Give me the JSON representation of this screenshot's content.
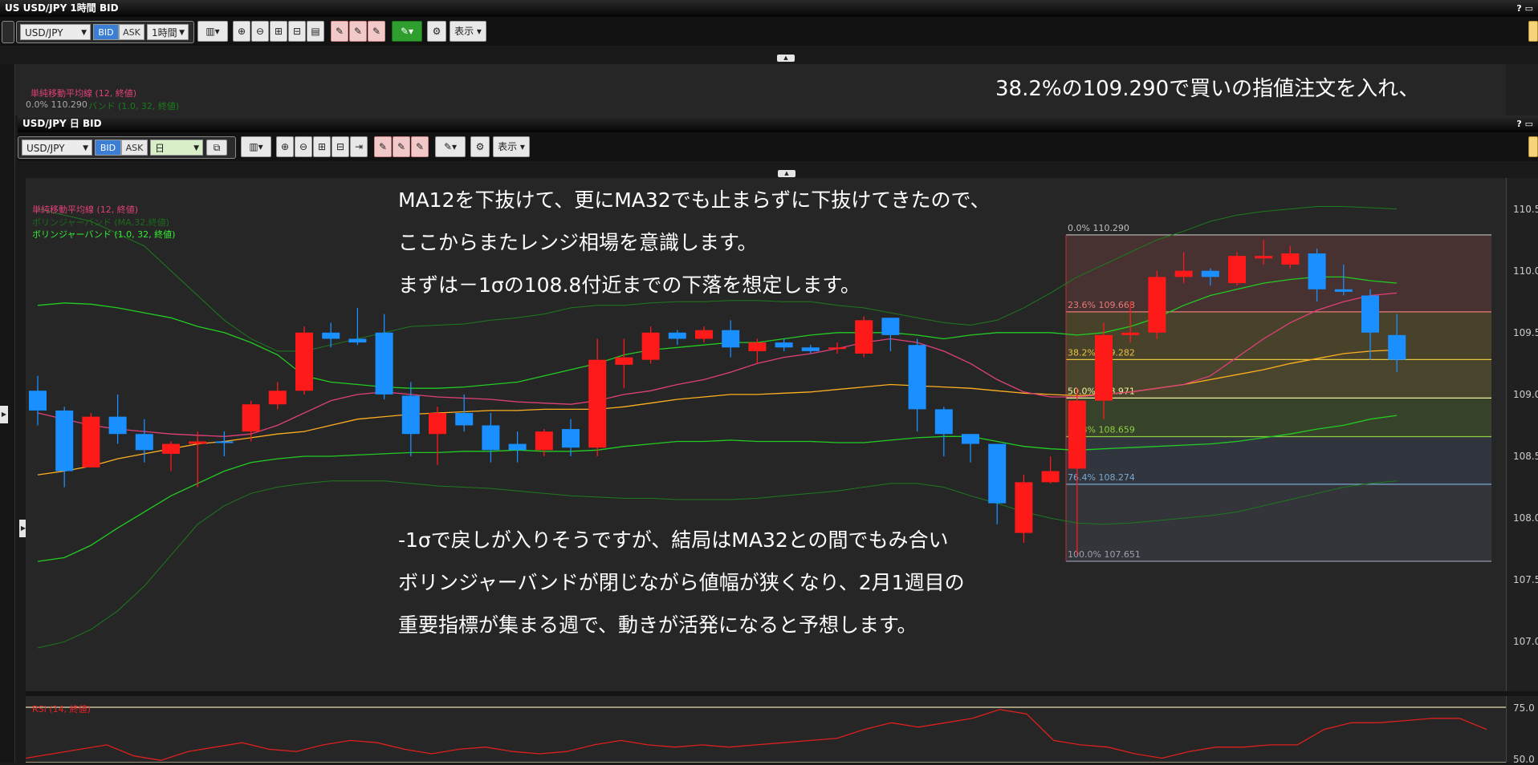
{
  "top_window": {
    "title": "USD/JPY 1時間 BID",
    "title_prefix": "US",
    "help": "?",
    "symbol": "USD/JPY",
    "bid": "BID",
    "ask": "ASK",
    "timeframe": "1時間",
    "display_menu": "表示",
    "sma_label": "単純移動平均線 (12, 終値)",
    "fib_label": "0.0% 110.290",
    "band_label": "バンド (1.0, 32, 終値)",
    "note": "38.2%の109.290で買いの指値注文を入れ、"
  },
  "main_window": {
    "title": "USD/JPY 日 BID",
    "help": "?",
    "symbol": "USD/JPY",
    "bid": "BID",
    "ask": "ASK",
    "timeframe": "日",
    "display_menu": "表示",
    "indicators": {
      "sma": "単純移動平均線 (12, 終値)",
      "bb_hidden": "ボリンジャーバンド (MA,32,終値)",
      "bb": "ボリンジャーバンド (1.0, 32, 終値)"
    },
    "notes": [
      "MA12を下抜けて、更にMA32でも止まらずに下抜けてきたので、",
      "ここからまたレンジ相場を意識します。",
      "まずは－1σの108.8付近までの下落を想定します。",
      "-1σで戻しが入りそうですが、結局はMA32との間でもみ合い",
      "ボリンジャーバンドが閉じながら値幅が狭くなり、2月1週目の",
      "重要指標が集まる週で、動きが活発になると予想します。"
    ],
    "price_scale": [
      "110.5",
      "110.0",
      "109.5",
      "109.0",
      "108.5",
      "108.0",
      "107.5",
      "107.0"
    ],
    "rsi_label": "RSI (14, 終値)",
    "rsi_scale": [
      "75.0",
      "50.0"
    ]
  },
  "colors": {
    "up": "#ff1a1a",
    "down": "#1a8fff",
    "sma": "#e0407a",
    "mid": "#ffb020",
    "band": "#22cc22",
    "accent_bid": "#3a7fd5"
  },
  "chart_data": {
    "type": "candlestick",
    "symbol": "USD/JPY",
    "timeframe": "日",
    "ylim": [
      106.6,
      110.75
    ],
    "candles": [
      {
        "o": 109.03,
        "h": 109.15,
        "l": 108.75,
        "c": 108.87
      },
      {
        "o": 108.87,
        "h": 108.9,
        "l": 108.25,
        "c": 108.38
      },
      {
        "o": 108.41,
        "h": 108.85,
        "l": 108.41,
        "c": 108.82
      },
      {
        "o": 108.82,
        "h": 109.0,
        "l": 108.6,
        "c": 108.68
      },
      {
        "o": 108.68,
        "h": 108.8,
        "l": 108.45,
        "c": 108.55
      },
      {
        "o": 108.52,
        "h": 108.62,
        "l": 108.38,
        "c": 108.6
      },
      {
        "o": 108.6,
        "h": 108.7,
        "l": 108.25,
        "c": 108.62
      },
      {
        "o": 108.62,
        "h": 108.7,
        "l": 108.5,
        "c": 108.61
      },
      {
        "o": 108.7,
        "h": 108.95,
        "l": 108.62,
        "c": 108.92
      },
      {
        "o": 108.92,
        "h": 109.1,
        "l": 108.88,
        "c": 109.03
      },
      {
        "o": 109.03,
        "h": 109.55,
        "l": 109.0,
        "c": 109.5
      },
      {
        "o": 109.5,
        "h": 109.58,
        "l": 109.38,
        "c": 109.45
      },
      {
        "o": 109.45,
        "h": 109.7,
        "l": 109.4,
        "c": 109.42
      },
      {
        "o": 109.5,
        "h": 109.65,
        "l": 108.96,
        "c": 109.0
      },
      {
        "o": 108.99,
        "h": 109.1,
        "l": 108.5,
        "c": 108.68
      },
      {
        "o": 108.68,
        "h": 108.9,
        "l": 108.43,
        "c": 108.85
      },
      {
        "o": 108.85,
        "h": 109.0,
        "l": 108.7,
        "c": 108.75
      },
      {
        "o": 108.75,
        "h": 108.85,
        "l": 108.45,
        "c": 108.55
      },
      {
        "o": 108.6,
        "h": 108.7,
        "l": 108.45,
        "c": 108.55
      },
      {
        "o": 108.55,
        "h": 108.72,
        "l": 108.5,
        "c": 108.7
      },
      {
        "o": 108.72,
        "h": 108.8,
        "l": 108.5,
        "c": 108.57
      },
      {
        "o": 108.57,
        "h": 109.45,
        "l": 108.5,
        "c": 109.28
      },
      {
        "o": 109.24,
        "h": 109.45,
        "l": 109.05,
        "c": 109.3
      },
      {
        "o": 109.28,
        "h": 109.55,
        "l": 109.25,
        "c": 109.5
      },
      {
        "o": 109.5,
        "h": 109.52,
        "l": 109.4,
        "c": 109.45
      },
      {
        "o": 109.45,
        "h": 109.55,
        "l": 109.42,
        "c": 109.52
      },
      {
        "o": 109.52,
        "h": 109.6,
        "l": 109.3,
        "c": 109.38
      },
      {
        "o": 109.35,
        "h": 109.45,
        "l": 109.25,
        "c": 109.42
      },
      {
        "o": 109.42,
        "h": 109.45,
        "l": 109.35,
        "c": 109.38
      },
      {
        "o": 109.38,
        "h": 109.4,
        "l": 109.33,
        "c": 109.35
      },
      {
        "o": 109.37,
        "h": 109.42,
        "l": 109.33,
        "c": 109.38
      },
      {
        "o": 109.33,
        "h": 109.63,
        "l": 109.3,
        "c": 109.6
      },
      {
        "o": 109.62,
        "h": 109.62,
        "l": 109.35,
        "c": 109.48
      },
      {
        "o": 109.4,
        "h": 109.45,
        "l": 108.7,
        "c": 108.88
      },
      {
        "o": 108.88,
        "h": 108.9,
        "l": 108.5,
        "c": 108.68
      },
      {
        "o": 108.68,
        "h": 108.68,
        "l": 108.45,
        "c": 108.6
      },
      {
        "o": 108.6,
        "h": 108.6,
        "l": 107.95,
        "c": 108.12
      },
      {
        "o": 107.88,
        "h": 108.35,
        "l": 107.8,
        "c": 108.29
      },
      {
        "o": 108.29,
        "h": 108.5,
        "l": 108.28,
        "c": 108.38
      },
      {
        "o": 108.4,
        "h": 109.05,
        "l": 107.7,
        "c": 108.95
      },
      {
        "o": 108.95,
        "h": 109.58,
        "l": 108.8,
        "c": 109.48
      },
      {
        "o": 109.48,
        "h": 109.75,
        "l": 109.42,
        "c": 109.5
      },
      {
        "o": 109.5,
        "h": 110.0,
        "l": 109.45,
        "c": 109.95
      },
      {
        "o": 109.95,
        "h": 110.15,
        "l": 109.9,
        "c": 110.0
      },
      {
        "o": 110.0,
        "h": 110.02,
        "l": 109.88,
        "c": 109.95
      },
      {
        "o": 109.9,
        "h": 110.15,
        "l": 109.88,
        "c": 110.12
      },
      {
        "o": 110.1,
        "h": 110.25,
        "l": 110.05,
        "c": 110.12
      },
      {
        "o": 110.05,
        "h": 110.2,
        "l": 110.02,
        "c": 110.14
      },
      {
        "o": 110.14,
        "h": 110.18,
        "l": 109.75,
        "c": 109.85
      },
      {
        "o": 109.85,
        "h": 110.05,
        "l": 109.8,
        "c": 109.83
      },
      {
        "o": 109.8,
        "h": 109.85,
        "l": 109.28,
        "c": 109.5
      },
      {
        "o": 109.48,
        "h": 109.65,
        "l": 109.18,
        "c": 109.28
      }
    ],
    "sma12": [
      108.85,
      108.8,
      108.75,
      108.72,
      108.7,
      108.68,
      108.67,
      108.66,
      108.68,
      108.75,
      108.85,
      108.95,
      109.0,
      109.02,
      109.0,
      108.98,
      108.97,
      108.96,
      108.94,
      108.93,
      108.92,
      108.95,
      109.0,
      109.03,
      109.08,
      109.12,
      109.18,
      109.25,
      109.3,
      109.33,
      109.37,
      109.42,
      109.45,
      109.42,
      109.35,
      109.25,
      109.12,
      109.02,
      108.98,
      108.98,
      109.0,
      109.02,
      109.05,
      109.08,
      109.15,
      109.3,
      109.45,
      109.58,
      109.68,
      109.75,
      109.8,
      109.82
    ],
    "bb_mid": [
      108.35,
      108.38,
      108.42,
      108.48,
      108.52,
      108.56,
      108.6,
      108.62,
      108.65,
      108.68,
      108.7,
      108.75,
      108.8,
      108.82,
      108.84,
      108.85,
      108.86,
      108.87,
      108.87,
      108.88,
      108.88,
      108.88,
      108.9,
      108.93,
      108.96,
      108.98,
      109.0,
      109.0,
      109.01,
      109.02,
      109.04,
      109.06,
      109.08,
      109.07,
      109.06,
      109.05,
      109.03,
      109.01,
      109.0,
      108.99,
      109.0,
      109.02,
      109.05,
      109.08,
      109.12,
      109.16,
      109.2,
      109.25,
      109.29,
      109.33,
      109.35,
      109.36
    ],
    "bb_upper": [
      109.72,
      109.74,
      109.73,
      109.7,
      109.66,
      109.62,
      109.55,
      109.5,
      109.42,
      109.32,
      109.15,
      109.1,
      109.08,
      109.06,
      109.05,
      109.05,
      109.06,
      109.08,
      109.1,
      109.15,
      109.2,
      109.25,
      109.32,
      109.36,
      109.38,
      109.4,
      109.42,
      109.42,
      109.45,
      109.48,
      109.5,
      109.5,
      109.5,
      109.48,
      109.45,
      109.48,
      109.5,
      109.5,
      109.5,
      109.48,
      109.5,
      109.55,
      109.62,
      109.72,
      109.8,
      109.85,
      109.9,
      109.93,
      109.95,
      109.95,
      109.92,
      109.9
    ],
    "bb_lower": [
      107.65,
      107.68,
      107.78,
      107.92,
      108.05,
      108.18,
      108.28,
      108.38,
      108.45,
      108.48,
      108.5,
      108.5,
      108.51,
      108.52,
      108.53,
      108.53,
      108.54,
      108.54,
      108.55,
      108.54,
      108.54,
      108.55,
      108.58,
      108.6,
      108.62,
      108.62,
      108.63,
      108.62,
      108.62,
      108.62,
      108.61,
      108.61,
      108.63,
      108.65,
      108.66,
      108.66,
      108.62,
      108.58,
      108.56,
      108.55,
      108.56,
      108.57,
      108.58,
      108.59,
      108.6,
      108.62,
      108.65,
      108.68,
      108.72,
      108.75,
      108.8,
      108.83
    ],
    "bb_outer_upper": [
      110.5,
      110.45,
      110.4,
      110.3,
      110.2,
      110.0,
      109.8,
      109.6,
      109.45,
      109.35,
      109.35,
      109.4,
      109.45,
      109.5,
      109.55,
      109.56,
      109.57,
      109.6,
      109.62,
      109.65,
      109.7,
      109.72,
      109.72,
      109.74,
      109.75,
      109.75,
      109.76,
      109.76,
      109.75,
      109.75,
      109.72,
      109.7,
      109.66,
      109.62,
      109.58,
      109.56,
      109.6,
      109.7,
      109.82,
      109.95,
      110.05,
      110.15,
      110.25,
      110.32,
      110.4,
      110.45,
      110.48,
      110.5,
      110.52,
      110.52,
      110.51,
      110.5
    ],
    "bb_outer_lower": [
      106.95,
      107.0,
      107.1,
      107.25,
      107.45,
      107.7,
      107.95,
      108.1,
      108.2,
      108.25,
      108.28,
      108.3,
      108.3,
      108.3,
      108.28,
      108.26,
      108.25,
      108.24,
      108.22,
      108.2,
      108.18,
      108.17,
      108.16,
      108.16,
      108.15,
      108.15,
      108.15,
      108.16,
      108.18,
      108.2,
      108.22,
      108.25,
      108.28,
      108.28,
      108.25,
      108.18,
      108.12,
      108.05,
      108.0,
      107.96,
      107.95,
      107.96,
      107.98,
      108.0,
      108.02,
      108.05,
      108.1,
      108.15,
      108.2,
      108.25,
      108.28,
      108.3
    ],
    "fibonacci": [
      {
        "label": "0.0%",
        "value": 110.29
      },
      {
        "label": "23.6%",
        "value": 109.668
      },
      {
        "label": "38.2%",
        "value": 109.282
      },
      {
        "label": "50.0%",
        "value": 108.971
      },
      {
        "label": "61.8%",
        "value": 108.659
      },
      {
        "label": "76.4%",
        "value": 108.274
      },
      {
        "label": "100.0%",
        "value": 107.651
      }
    ],
    "rsi": {
      "ylim": [
        50,
        75
      ],
      "levels": [
        75,
        50
      ],
      "values": [
        52,
        54,
        56,
        58,
        53,
        51,
        55,
        57,
        59,
        56,
        55,
        58,
        60,
        59,
        56,
        54,
        56,
        57,
        55,
        54,
        55,
        58,
        60,
        58,
        57,
        58,
        57,
        58,
        59,
        60,
        61,
        65,
        68,
        66,
        68,
        70,
        74,
        72,
        60,
        58,
        57,
        54,
        52,
        55,
        57,
        57,
        58,
        58,
        65,
        68,
        68,
        69,
        70,
        70,
        65
      ]
    }
  }
}
